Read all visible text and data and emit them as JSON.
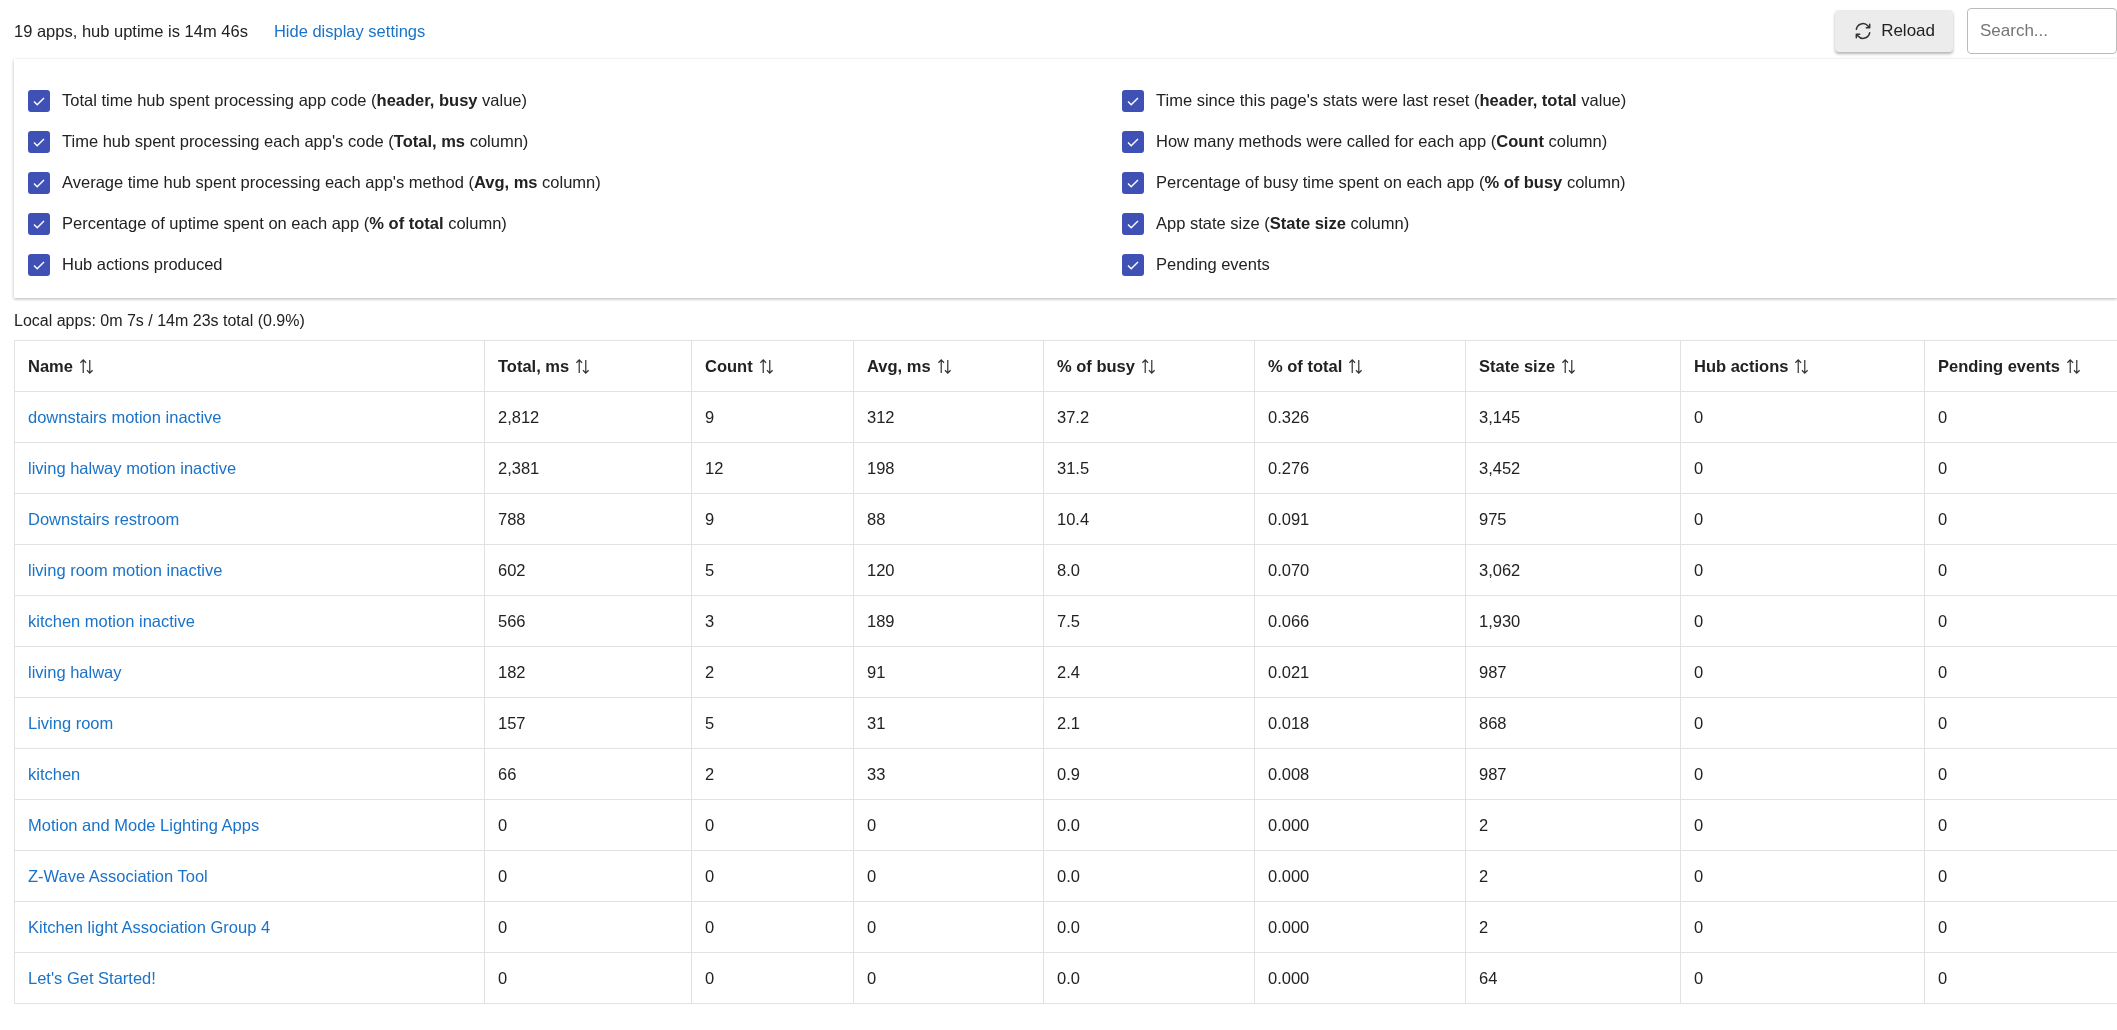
{
  "header": {
    "summary": "19 apps, hub uptime is 14m 46s",
    "toggle_link": "Hide display settings",
    "reload_button": "Reload",
    "search": {
      "placeholder": "Search..."
    }
  },
  "settings": [
    {
      "label": "Total time hub spent processing app code (**header, busy** value)",
      "checked": true
    },
    {
      "label": "Time since this page's stats were last reset (**header, total** value)",
      "checked": true
    },
    {
      "label": "Time hub spent processing each app's code (**Total, ms** column)",
      "checked": true
    },
    {
      "label": "How many methods were called for each app (**Count** column)",
      "checked": true
    },
    {
      "label": "Average time hub spent processing each app's method (**Avg, ms** column)",
      "checked": true
    },
    {
      "label": "Percentage of busy time spent on each app (**% of busy** column)",
      "checked": true
    },
    {
      "label": "Percentage of uptime spent on each app (**% of total** column)",
      "checked": true
    },
    {
      "label": "App state size (**State size** column)",
      "checked": true
    },
    {
      "label": "Hub actions produced",
      "checked": true
    },
    {
      "label": "Pending events",
      "checked": true
    }
  ],
  "local_apps_summary": "Local apps: 0m 7s / 14m 23s total (0.9%)",
  "table": {
    "columns": [
      "Name",
      "Total, ms",
      "Count",
      "Avg, ms",
      "% of busy",
      "% of total",
      "State size",
      "Hub actions",
      "Pending events"
    ],
    "rows": [
      [
        "downstairs motion inactive",
        "2,812",
        "9",
        "312",
        "37.2",
        "0.326",
        "3,145",
        "0",
        "0"
      ],
      [
        "living halway motion inactive",
        "2,381",
        "12",
        "198",
        "31.5",
        "0.276",
        "3,452",
        "0",
        "0"
      ],
      [
        "Downstairs restroom",
        "788",
        "9",
        "88",
        "10.4",
        "0.091",
        "975",
        "0",
        "0"
      ],
      [
        "living room motion inactive",
        "602",
        "5",
        "120",
        "8.0",
        "0.070",
        "3,062",
        "0",
        "0"
      ],
      [
        "kitchen motion inactive",
        "566",
        "3",
        "189",
        "7.5",
        "0.066",
        "1,930",
        "0",
        "0"
      ],
      [
        "living halway",
        "182",
        "2",
        "91",
        "2.4",
        "0.021",
        "987",
        "0",
        "0"
      ],
      [
        "Living room",
        "157",
        "5",
        "31",
        "2.1",
        "0.018",
        "868",
        "0",
        "0"
      ],
      [
        "kitchen",
        "66",
        "2",
        "33",
        "0.9",
        "0.008",
        "987",
        "0",
        "0"
      ],
      [
        "Motion and Mode Lighting Apps",
        "0",
        "0",
        "0",
        "0.0",
        "0.000",
        "2",
        "0",
        "0"
      ],
      [
        "Z-Wave Association Tool",
        "0",
        "0",
        "0",
        "0.0",
        "0.000",
        "2",
        "0",
        "0"
      ],
      [
        "Kitchen light Association Group 4",
        "0",
        "0",
        "0",
        "0.0",
        "0.000",
        "2",
        "0",
        "0"
      ],
      [
        "Let's Get Started!",
        "0",
        "0",
        "0",
        "0.0",
        "0.000",
        "64",
        "0",
        "0"
      ]
    ]
  }
}
